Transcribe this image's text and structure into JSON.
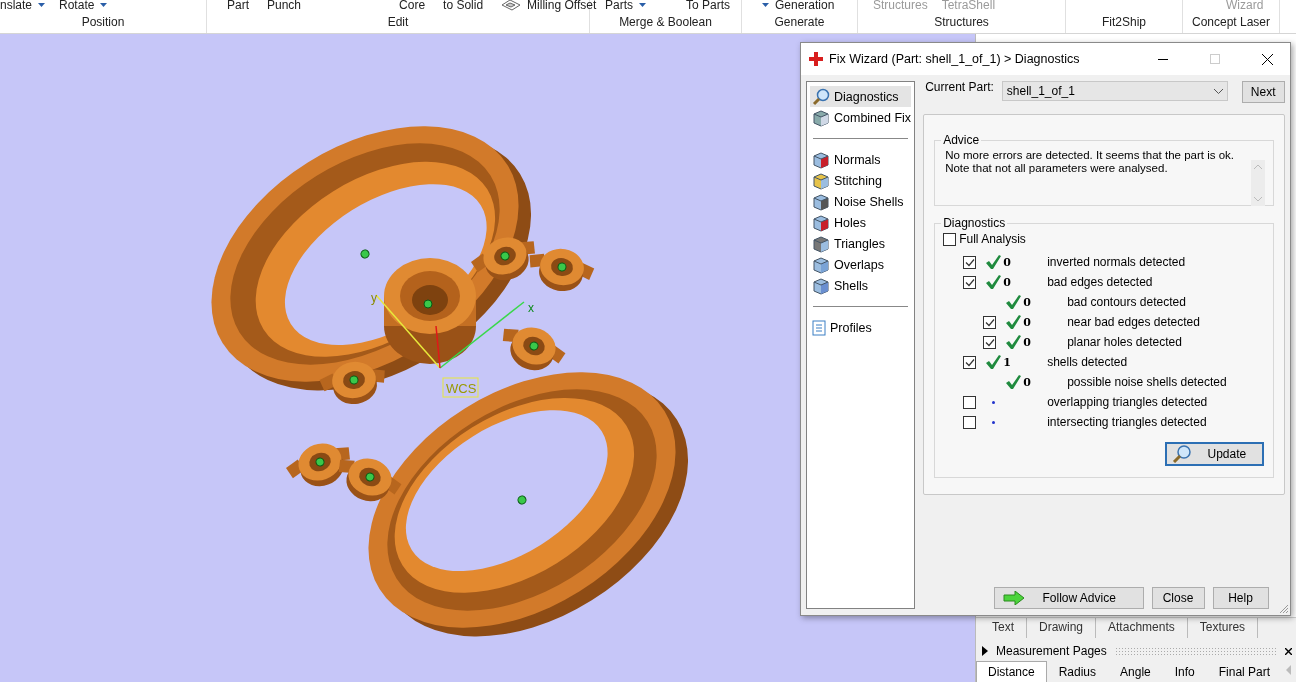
{
  "ribbon": {
    "groups": [
      {
        "label": "Position",
        "items": [
          {
            "label": "nslate",
            "kind": "dropdown",
            "disabled": false
          },
          {
            "label": "Rotate",
            "kind": "dropdown",
            "disabled": false
          }
        ]
      },
      {
        "label": "Edit",
        "items": [
          {
            "label": "Part",
            "kind": "button",
            "disabled": false
          },
          {
            "label": "Punch",
            "kind": "button",
            "disabled": false
          },
          {
            "label": "Core",
            "kind": "button",
            "disabled": false
          },
          {
            "label": "to Solid",
            "kind": "button",
            "disabled": false
          },
          {
            "label": "Milling Offset",
            "kind": "icon-button",
            "disabled": false
          }
        ]
      },
      {
        "label": "Merge & Boolean",
        "items": [
          {
            "label": "Parts",
            "kind": "dropdown",
            "disabled": false
          },
          {
            "label": "To Parts",
            "kind": "button",
            "disabled": false
          }
        ]
      },
      {
        "label": "Generate",
        "items": [
          {
            "label": "Generation",
            "kind": "caret-first",
            "disabled": false
          }
        ]
      },
      {
        "label": "Structures",
        "items": [
          {
            "label": "Structures",
            "kind": "button",
            "disabled": true
          },
          {
            "label": "TetraShell",
            "kind": "button",
            "disabled": true
          }
        ]
      },
      {
        "label": "Fit2Ship"
      },
      {
        "label": "Concept Laser",
        "items": [
          {
            "label": "Wizard",
            "kind": "button",
            "disabled": true
          }
        ]
      }
    ]
  },
  "viewport": {
    "wcs_label": "WCS",
    "axis_labels": [
      "x",
      "y"
    ]
  },
  "dialog": {
    "title": "Fix Wizard (Part: shell_1_of_1) > Diagnostics",
    "nav_groups": [
      [
        {
          "label": "Diagnostics",
          "selected": true
        },
        {
          "label": "Combined Fix",
          "selected": false
        }
      ],
      [
        {
          "label": "Normals",
          "selected": false
        },
        {
          "label": "Stitching",
          "selected": false
        },
        {
          "label": "Noise Shells",
          "selected": false
        },
        {
          "label": "Holes",
          "selected": false
        },
        {
          "label": "Triangles",
          "selected": false
        },
        {
          "label": "Overlaps",
          "selected": false
        },
        {
          "label": "Shells",
          "selected": false
        }
      ],
      [
        {
          "label": "Profiles",
          "selected": false
        }
      ]
    ],
    "current_part": {
      "label": "Current Part:",
      "value": "shell_1_of_1"
    },
    "next_button": "Next",
    "advice": {
      "title": "Advice",
      "lines": [
        "No more errors are detected. It seems that the part is ok.",
        "Note that not all parameters were analysed."
      ]
    },
    "diagnostics": {
      "title": "Diagnostics",
      "full_analysis": {
        "label": "Full Analysis",
        "checked": false
      },
      "checks": [
        {
          "checked": true,
          "passed": true,
          "count": "0",
          "label": "inverted normals detected"
        },
        {
          "checked": true,
          "passed": true,
          "count": "0",
          "label": "bad edges detected",
          "children": [
            {
              "passed": true,
              "count": "0",
              "label": "bad contours detected"
            },
            {
              "checked": true,
              "passed": true,
              "count": "0",
              "label": "near bad edges detected"
            },
            {
              "checked": true,
              "passed": true,
              "count": "0",
              "label": "planar holes detected"
            }
          ]
        },
        {
          "checked": true,
          "passed": true,
          "count": "1",
          "label": "shells detected",
          "children": [
            {
              "passed": true,
              "count": "0",
              "label": "possible noise shells detected"
            }
          ]
        },
        {
          "checked": false,
          "passed": false,
          "label": "overlapping triangles detected"
        },
        {
          "checked": false,
          "passed": false,
          "label": "intersecting triangles detected"
        }
      ],
      "update_button": "Update"
    },
    "buttons": [
      {
        "label": "Follow Advice",
        "kind": "advice"
      },
      {
        "label": "Close",
        "kind": "plain"
      },
      {
        "label": "Help",
        "kind": "plain"
      }
    ]
  },
  "side_panel": {
    "attachment_tabs": [
      "Text",
      "Drawing",
      "Attachments",
      "Textures"
    ],
    "measurement": {
      "title": "Measurement Pages",
      "tabs": [
        {
          "label": "Distance",
          "selected": true
        },
        {
          "label": "Radius",
          "selected": false
        },
        {
          "label": "Angle",
          "selected": false
        },
        {
          "label": "Info",
          "selected": false
        },
        {
          "label": "Final Part",
          "selected": false
        }
      ]
    }
  }
}
